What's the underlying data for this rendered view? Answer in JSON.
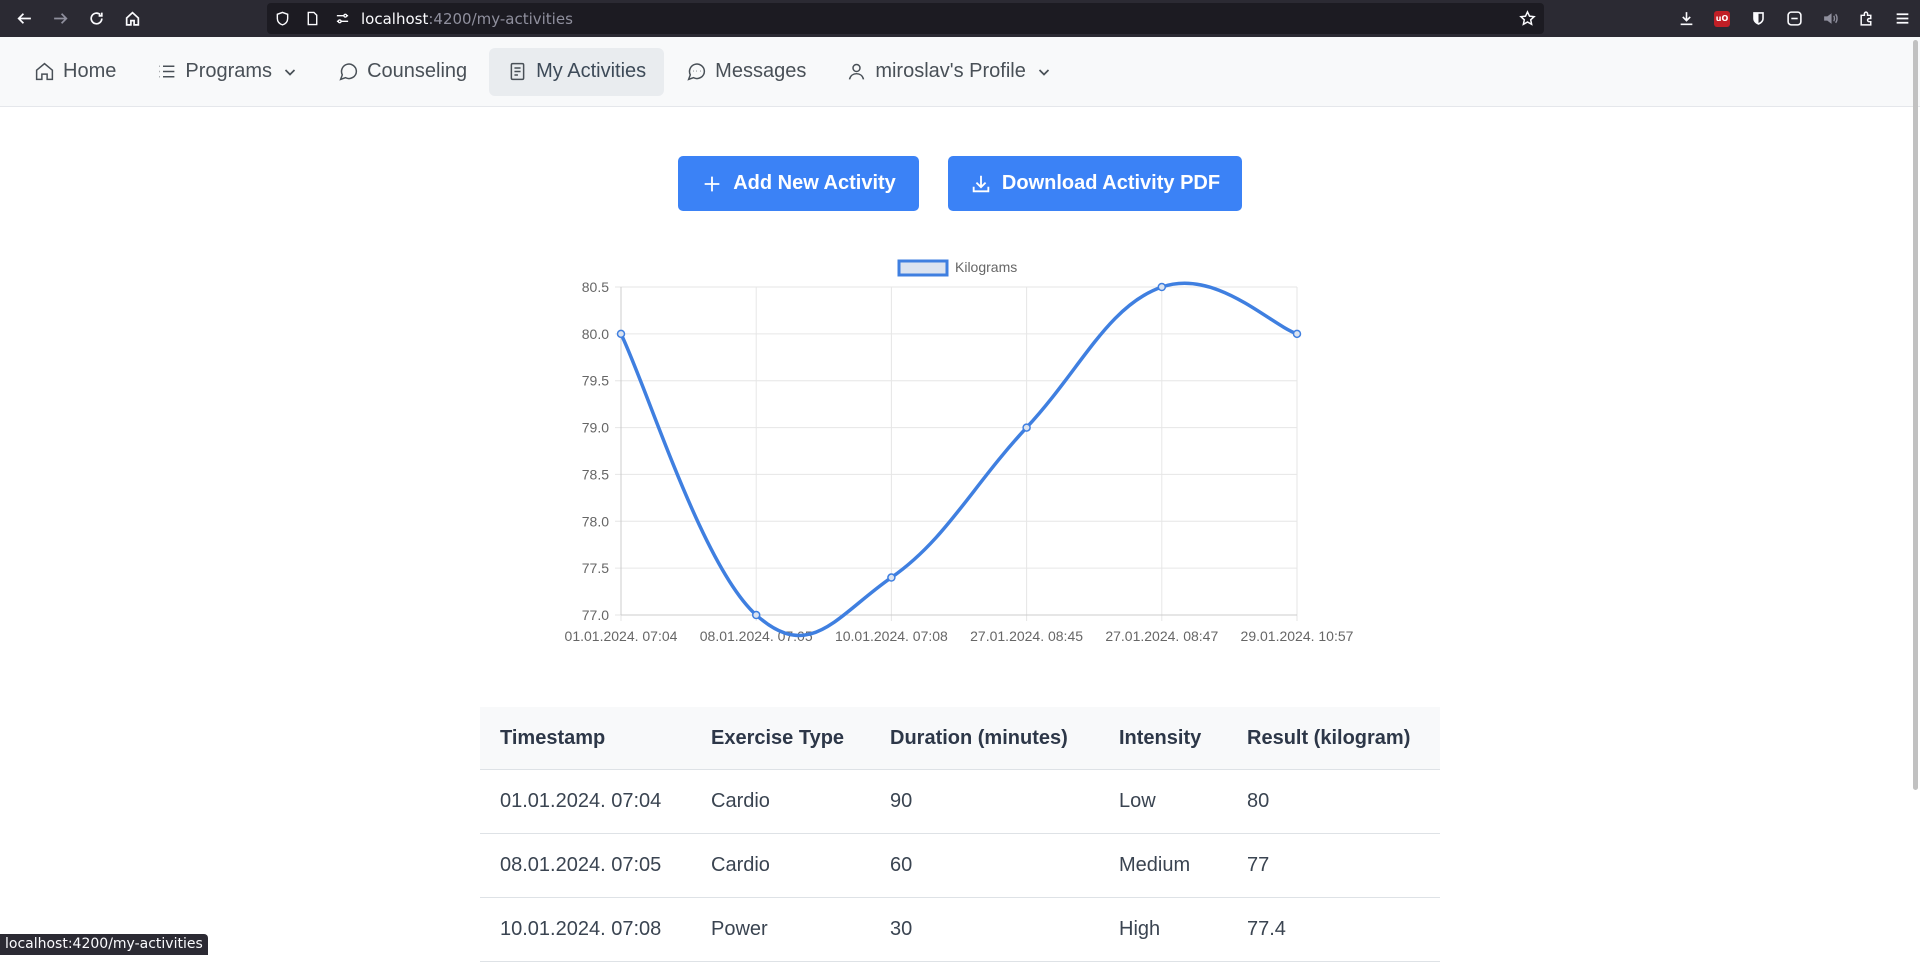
{
  "browser": {
    "url_host": "localhost",
    "url_path": ":4200/my-activities",
    "status_url": "localhost:4200/my-activities"
  },
  "nav": {
    "home": "Home",
    "programs": "Programs",
    "counseling": "Counseling",
    "activities": "My Activities",
    "messages": "Messages",
    "profile": "miroslav's Profile"
  },
  "actions": {
    "add": "Add New Activity",
    "pdf": "Download Activity PDF"
  },
  "chart_data": {
    "type": "line",
    "categories": [
      "01.01.2024. 07:04",
      "08.01.2024. 07:05",
      "10.01.2024. 07:08",
      "27.01.2024. 08:45",
      "27.01.2024. 08:47",
      "29.01.2024. 10:57"
    ],
    "series": [
      {
        "name": "Kilograms",
        "values": [
          80,
          77,
          77.4,
          79,
          80.5,
          80
        ]
      }
    ],
    "yticks": [
      "80.5",
      "80.0",
      "79.5",
      "79.0",
      "78.5",
      "78.0",
      "77.5",
      "77.0"
    ],
    "ylim": [
      77,
      80.5
    ],
    "grid": true,
    "legend": "top-center",
    "color": "#3f7fe0"
  },
  "table": {
    "headers": [
      "Timestamp",
      "Exercise Type",
      "Duration (minutes)",
      "Intensity",
      "Result (kilogram)"
    ],
    "rows": [
      [
        "01.01.2024. 07:04",
        "Cardio",
        "90",
        "Low",
        "80"
      ],
      [
        "08.01.2024. 07:05",
        "Cardio",
        "60",
        "Medium",
        "77"
      ],
      [
        "10.01.2024. 07:08",
        "Power",
        "30",
        "High",
        "77.4"
      ]
    ]
  }
}
